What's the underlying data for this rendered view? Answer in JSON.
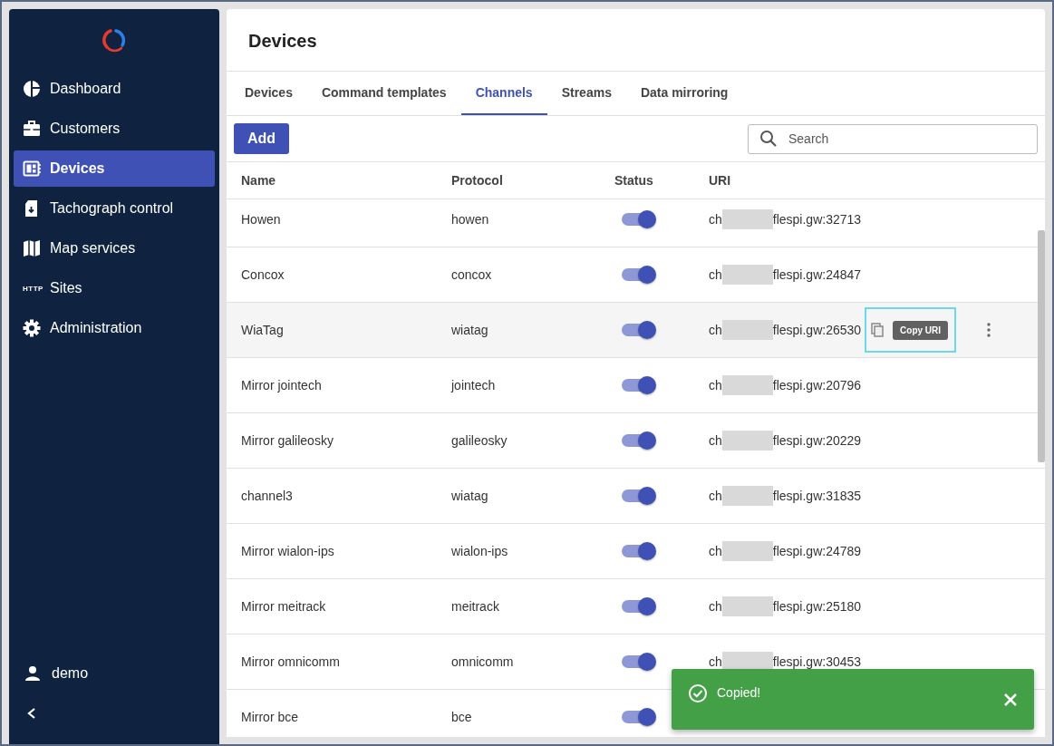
{
  "sidebar": {
    "items": [
      {
        "label": "Dashboard",
        "selected": false
      },
      {
        "label": "Customers",
        "selected": false
      },
      {
        "label": "Devices",
        "selected": true
      },
      {
        "label": "Tachograph control",
        "selected": false
      },
      {
        "label": "Map services",
        "selected": false
      },
      {
        "label": "Sites",
        "icon_text": "HTTP",
        "selected": false
      },
      {
        "label": "Administration",
        "selected": false
      }
    ],
    "user": "demo"
  },
  "page": {
    "title": "Devices"
  },
  "tabs": [
    {
      "label": "Devices",
      "selected": false
    },
    {
      "label": "Command templates",
      "selected": false
    },
    {
      "label": "Channels",
      "selected": true
    },
    {
      "label": "Streams",
      "selected": false
    },
    {
      "label": "Data mirroring",
      "selected": false
    }
  ],
  "toolbar": {
    "add_button": "Add",
    "search": {
      "placeholder": "Search"
    }
  },
  "table": {
    "columns": [
      "Name",
      "Protocol",
      "Status",
      "URI"
    ],
    "rows": [
      {
        "name": "Howen",
        "protocol": "howen",
        "on": true,
        "uri_start": "ch",
        "uri_end": "flespi.gw:32713",
        "hovered": false
      },
      {
        "name": "Concox",
        "protocol": "concox",
        "on": true,
        "uri_start": "ch",
        "uri_end": "flespi.gw:24847",
        "hovered": false
      },
      {
        "name": "WiaTag",
        "protocol": "wiatag",
        "on": true,
        "uri_start": "ch",
        "uri_end": "flespi.gw:26530",
        "hovered": true,
        "tooltip": "Copy URI"
      },
      {
        "name": "Mirror jointech",
        "protocol": "jointech",
        "on": true,
        "uri_start": "ch",
        "uri_end": "flespi.gw:20796",
        "hovered": false
      },
      {
        "name": "Mirror galileosky",
        "protocol": "galileosky",
        "on": true,
        "uri_start": "ch",
        "uri_end": "flespi.gw:20229",
        "hovered": false
      },
      {
        "name": "channel3",
        "protocol": "wiatag",
        "on": true,
        "uri_start": "ch",
        "uri_end": "flespi.gw:31835",
        "hovered": false
      },
      {
        "name": "Mirror wialon-ips",
        "protocol": "wialon-ips",
        "on": true,
        "uri_start": "ch",
        "uri_end": "flespi.gw:24789",
        "hovered": false
      },
      {
        "name": "Mirror meitrack",
        "protocol": "meitrack",
        "on": true,
        "uri_start": "ch",
        "uri_end": "flespi.gw:25180",
        "hovered": false
      },
      {
        "name": "Mirror omnicomm",
        "protocol": "omnicomm",
        "on": true,
        "uri_start": "ch",
        "uri_end": "flespi.gw:30453",
        "hovered": false
      },
      {
        "name": "Mirror bce",
        "protocol": "bce",
        "on": true,
        "hovered": false
      }
    ]
  },
  "toast": {
    "message": "Copied!"
  }
}
